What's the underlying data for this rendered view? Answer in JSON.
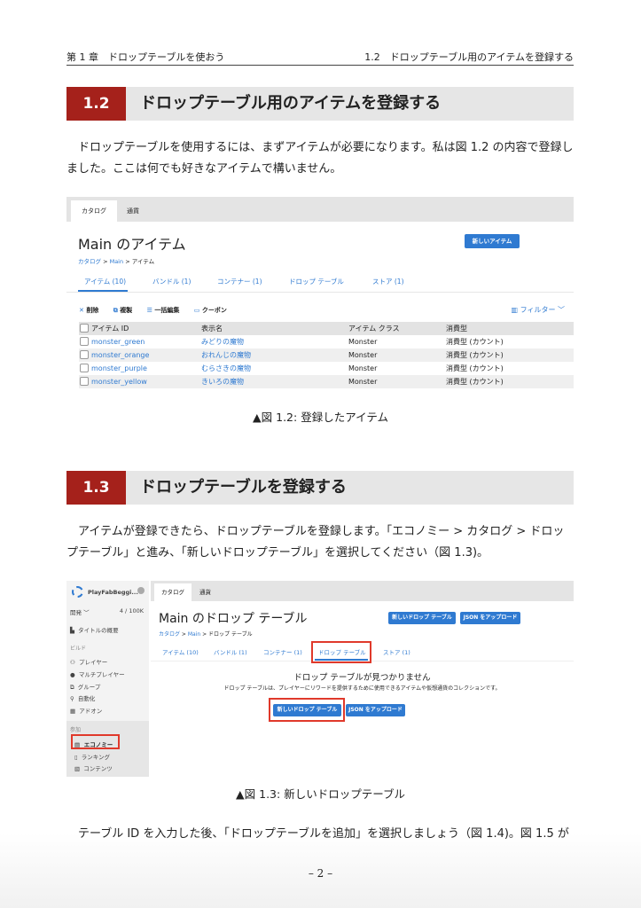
{
  "header": {
    "chapter": "第 1 章　ドロップテーブルを使おう",
    "section": "1.2　ドロップテーブル用のアイテムを登録する"
  },
  "sec12": {
    "num": "1.2",
    "title": "ドロップテーブル用のアイテムを登録する",
    "para": "ドロップテーブルを使用するには、まずアイテムが必要になります。私は図 1.2 の内容で登録しました。ここは何でも好きなアイテムで構いません。",
    "caption": "▲図 1.2: 登録したアイテム"
  },
  "fig1": {
    "tabs": [
      "カタログ",
      "通貨"
    ],
    "title": "Main のアイテム",
    "new_button": "新しいアイテム",
    "breadcrumb": [
      "カタログ",
      "Main",
      "アイテム"
    ],
    "subtabs": [
      "アイテム (10)",
      "バンドル (1)",
      "コンテナー (1)",
      "ドロップ テーブル",
      "ストア (1)"
    ],
    "toolbar": [
      "削除",
      "複製",
      "一括編集",
      "クーポン"
    ],
    "filter": "フィルター",
    "columns": [
      "アイテム ID",
      "表示名",
      "アイテム クラス",
      "消費型"
    ],
    "rows": [
      [
        "monster_green",
        "みどりの魔物",
        "Monster",
        "消費型 (カウント)"
      ],
      [
        "monster_orange",
        "おれんじの魔物",
        "Monster",
        "消費型 (カウント)"
      ],
      [
        "monster_purple",
        "むらさきの魔物",
        "Monster",
        "消費型 (カウント)"
      ],
      [
        "monster_yellow",
        "きいろの魔物",
        "Monster",
        "消費型 (カウント)"
      ]
    ]
  },
  "sec13": {
    "num": "1.3",
    "title": "ドロップテーブルを登録する",
    "para": "アイテムが登録できたら、ドロップテーブルを登録します。「エコノミー > カタログ > ドロップテーブル」と進み、「新しいドロップテーブル」を選択してください（図 1.3)。",
    "caption": "▲図 1.3: 新しいドロップテーブル"
  },
  "fig2": {
    "project": "PlayFabBeggi...",
    "env": "開発",
    "count": "4 / 100K",
    "overview": "タイトルの概要",
    "build_label": "ビルド",
    "build_items": [
      "プレイヤー",
      "マルチプレイヤー",
      "グループ",
      "自動化",
      "アドオン"
    ],
    "engage_label": "参加",
    "engage_items": [
      "エコノミー",
      "ランキング",
      "コンテンツ"
    ],
    "tabs": [
      "カタログ",
      "通貨"
    ],
    "title": "Main のドロップ テーブル",
    "new_button": "新しいドロップ テーブル",
    "upload_button": "JSON をアップロード",
    "breadcrumb": [
      "カタログ",
      "Main",
      "ドロップ テーブル"
    ],
    "subtabs": [
      "アイテム (10)",
      "バンドル (1)",
      "コンテナー (1)",
      "ドロップ テーブル",
      "ストア (1)"
    ],
    "empty_title": "ドロップ テーブルが見つかりません",
    "empty_desc": "ドロップ テーブルは、プレイヤーにリワードを提供するために使用できるアイテムや仮想通貨のコレクションです。"
  },
  "para3": "テーブル ID を入力した後、「ドロップテーブルを追加」を選択しましょう（図 1.4)。図 1.5 が",
  "page_number": "– 2 –"
}
